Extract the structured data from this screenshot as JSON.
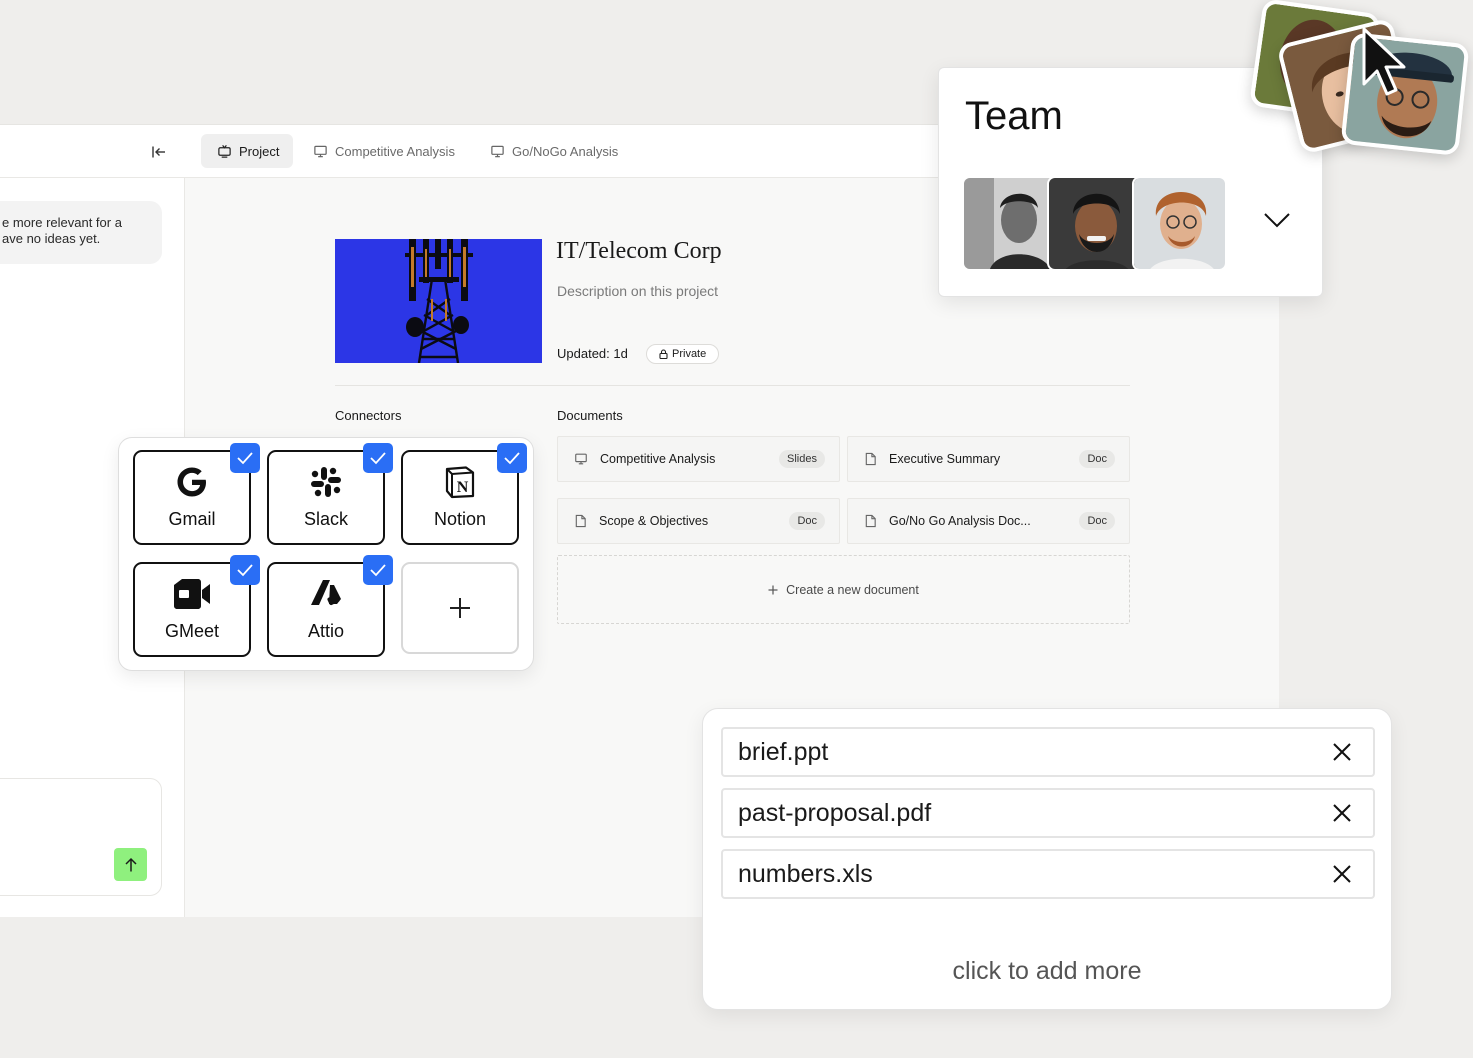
{
  "tabs": [
    {
      "label": "Project",
      "icon": "tv-icon",
      "active": true
    },
    {
      "label": "Competitive Analysis",
      "icon": "presentation-icon",
      "active": false
    },
    {
      "label": "Go/NoGo Analysis",
      "icon": "presentation-icon",
      "active": false
    }
  ],
  "chat": {
    "bubble_line1": "e more relevant for a",
    "bubble_line2": "ave no ideas yet."
  },
  "project": {
    "title": "IT/Telecom Corp",
    "description": "Description on this project",
    "updated": "Updated: 1d",
    "visibility": "Private"
  },
  "sections": {
    "connectors": "Connectors",
    "documents": "Documents"
  },
  "documents": [
    {
      "name": "Competitive Analysis",
      "type": "Slides",
      "icon": "presentation-icon"
    },
    {
      "name": "Executive Summary",
      "type": "Doc",
      "icon": "file-icon"
    },
    {
      "name": "Scope & Objectives",
      "type": "Doc",
      "icon": "file-icon"
    },
    {
      "name": "Go/No Go Analysis Doc...",
      "type": "Doc",
      "icon": "file-icon"
    }
  ],
  "create_document": "Create a new document",
  "connectors": [
    {
      "label": "Gmail",
      "icon": "google-icon",
      "checked": true
    },
    {
      "label": "Slack",
      "icon": "slack-icon",
      "checked": true
    },
    {
      "label": "Notion",
      "icon": "notion-icon",
      "checked": true
    },
    {
      "label": "GMeet",
      "icon": "video-camera-icon",
      "checked": true
    },
    {
      "label": "Attio",
      "icon": "attio-icon",
      "checked": true
    }
  ],
  "team": {
    "title": "Team"
  },
  "files": [
    {
      "name": "brief.ppt"
    },
    {
      "name": "past-proposal.pdf"
    },
    {
      "name": "numbers.xls"
    }
  ],
  "files_add_more": "click to add more",
  "colors": {
    "accent_check": "#2a6ef5",
    "send_button": "#8ff07e",
    "cover_background": "#2c36e6"
  }
}
